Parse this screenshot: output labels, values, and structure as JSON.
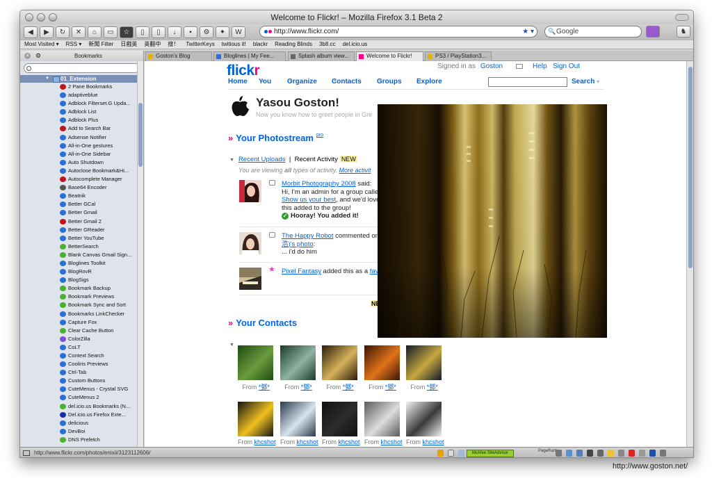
{
  "window": {
    "title": "Welcome to Flickr! – Mozilla Firefox 3.1 Beta 2"
  },
  "toolbar": {
    "url": "http://www.flickr.com/",
    "search_placeholder": "Google"
  },
  "bookmarks_toolbar": [
    "Most Visited ▾",
    "RSS ▾",
    "新聞 Filter",
    "日戲英",
    "英翻中",
    "搜！",
    "TwitterKeys",
    "twitious it!",
    "blackr",
    "Reading Blinds",
    "3b8.cc",
    "del.icio.us"
  ],
  "sidebar": {
    "title": "Bookmarks",
    "folder": "01_Extension",
    "items": [
      {
        "label": "2 Pane Bookmarks",
        "color": "#c0151a"
      },
      {
        "label": "adaptiveblue",
        "color": "#2a6fd6"
      },
      {
        "label": "Adblock Filterset.G Upda...",
        "color": "#2a6fd6"
      },
      {
        "label": "Adblock List",
        "color": "#2a6fd6"
      },
      {
        "label": "Adblock Plus",
        "color": "#2a6fd6"
      },
      {
        "label": "Add to Search Bar",
        "color": "#c0151a"
      },
      {
        "label": "Adsense Notifier",
        "color": "#2a6fd6"
      },
      {
        "label": "All-in-One gestures",
        "color": "#2a6fd6"
      },
      {
        "label": "All-in-One Sidebar",
        "color": "#2a6fd6"
      },
      {
        "label": "Auto Shutdown",
        "color": "#2a6fd6"
      },
      {
        "label": "Autoclose Bookmark&Hi...",
        "color": "#2a6fd6"
      },
      {
        "label": "Autocomplete Manager",
        "color": "#c0151a"
      },
      {
        "label": "Base64 Encoder",
        "color": "#555555"
      },
      {
        "label": "Beatnik",
        "color": "#2a6fd6"
      },
      {
        "label": "Better GCal",
        "color": "#2a6fd6"
      },
      {
        "label": "Better Gmail",
        "color": "#2a6fd6"
      },
      {
        "label": "Better Gmail 2",
        "color": "#c0151a"
      },
      {
        "label": "Better GReader",
        "color": "#2a6fd6"
      },
      {
        "label": "Better YouTube",
        "color": "#2a6fd6"
      },
      {
        "label": "BetterSearch",
        "color": "#4caf2f"
      },
      {
        "label": "Blank Canvas Gmail Sign...",
        "color": "#4caf2f"
      },
      {
        "label": "Bloglines Toolkit",
        "color": "#2a6fd6"
      },
      {
        "label": "BlogRovR",
        "color": "#2a6fd6"
      },
      {
        "label": "BlogSigs",
        "color": "#2a6fd6"
      },
      {
        "label": "Bookmark Backup",
        "color": "#4caf2f"
      },
      {
        "label": "Bookmark Previews",
        "color": "#4caf2f"
      },
      {
        "label": "Bookmark Sync and Sort",
        "color": "#4caf2f"
      },
      {
        "label": "Bookmarks LinkChecker",
        "color": "#2a6fd6"
      },
      {
        "label": "Capture Fox",
        "color": "#2a6fd6"
      },
      {
        "label": "Clear Cache Button",
        "color": "#4caf2f"
      },
      {
        "label": "ColorZilla",
        "color": "#7a4fd6"
      },
      {
        "label": "CoLT",
        "color": "#2a6fd6"
      },
      {
        "label": "Context Search",
        "color": "#2a6fd6"
      },
      {
        "label": "Cooliris Previews",
        "color": "#2a6fd6"
      },
      {
        "label": "Ctrl-Tab",
        "color": "#2a6fd6"
      },
      {
        "label": "Custom Buttons",
        "color": "#2a6fd6"
      },
      {
        "label": "CuteMenus - Crystal SVG",
        "color": "#2a6fd6"
      },
      {
        "label": "CuteMenus 2",
        "color": "#2a6fd6"
      },
      {
        "label": "del.icio.us Bookmarks (N...",
        "color": "#4caf2f"
      },
      {
        "label": "Del.icio.us Firefox Exte...",
        "color": "#1a2fa8"
      },
      {
        "label": "delicious",
        "color": "#2a6fd6"
      },
      {
        "label": "DevBoi",
        "color": "#2a6fd6"
      },
      {
        "label": "DNS Prefetch",
        "color": "#4caf2f"
      }
    ]
  },
  "tabs": [
    {
      "label": "Goston's Blog",
      "active": false,
      "color": "#e8b100"
    },
    {
      "label": "Bloglines | My Fee...",
      "active": false,
      "color": "#2a6fd6"
    },
    {
      "label": "Splash album view...",
      "active": false,
      "color": "#666666"
    },
    {
      "label": "Welcome to Flickr!",
      "active": true,
      "color": "#ff0084"
    },
    {
      "label": "PS3 / PlayStation3...",
      "active": false,
      "color": "#e8b100"
    }
  ],
  "flickr": {
    "logo_main": "flick",
    "logo_accent": "r",
    "signed_in": "Signed in as",
    "username": "Goston",
    "help": "Help",
    "sign_out": "Sign Out",
    "nav": [
      "Home",
      "You",
      "Organize",
      "Contacts",
      "Groups",
      "Explore"
    ],
    "search_label": "Search",
    "greeting": "Yasou Goston!",
    "greeting_sub": "Now you know how to greet people in Gre",
    "photostream_title": "Your Photostream",
    "pro": "pro",
    "recent_uploads": "Recent Uploads",
    "recent_activity": "Recent Activity",
    "new_badge": "NEW",
    "viewing_prefix": "You are viewing",
    "viewing_all": "all",
    "viewing_suffix": "types of activity.",
    "more_activity": "More activit",
    "activity": [
      {
        "user": "Morbit Photography 2008",
        "said": "said:",
        "line2": "Hi, I'm an admin for a group calle",
        "link3": "Show us your best",
        "line3b": ", and we'd love",
        "line4": "this added to the group!",
        "hooray": "Hooray! You added it!"
      },
      {
        "user": "The Happy Robot",
        "verb": "commented on",
        "link2": "浩)'s photo",
        "colon": ":",
        "line3": "... i'd do him"
      },
      {
        "user": "Pixel Fantasy",
        "verb": "added this as a",
        "link": "fav"
      }
    ],
    "ne_badge": "NE",
    "contacts_title": "Your Contacts",
    "from": "From",
    "contacts_row1": [
      "*鄧*",
      "*鄧*",
      "*鄧*",
      "*鄧*",
      "*鄧*"
    ],
    "contacts_row2": [
      "khcshot",
      "khcshot",
      "khcshot",
      "khcshot",
      "khcshot"
    ]
  },
  "statusbar": {
    "url": "http://www.flickr.com/photos/enixii/3123112606/",
    "siteadvisor": "McAfee SiteAdvisor",
    "pagerank": "PageRank"
  },
  "watermark": "http://www.goston.net/"
}
